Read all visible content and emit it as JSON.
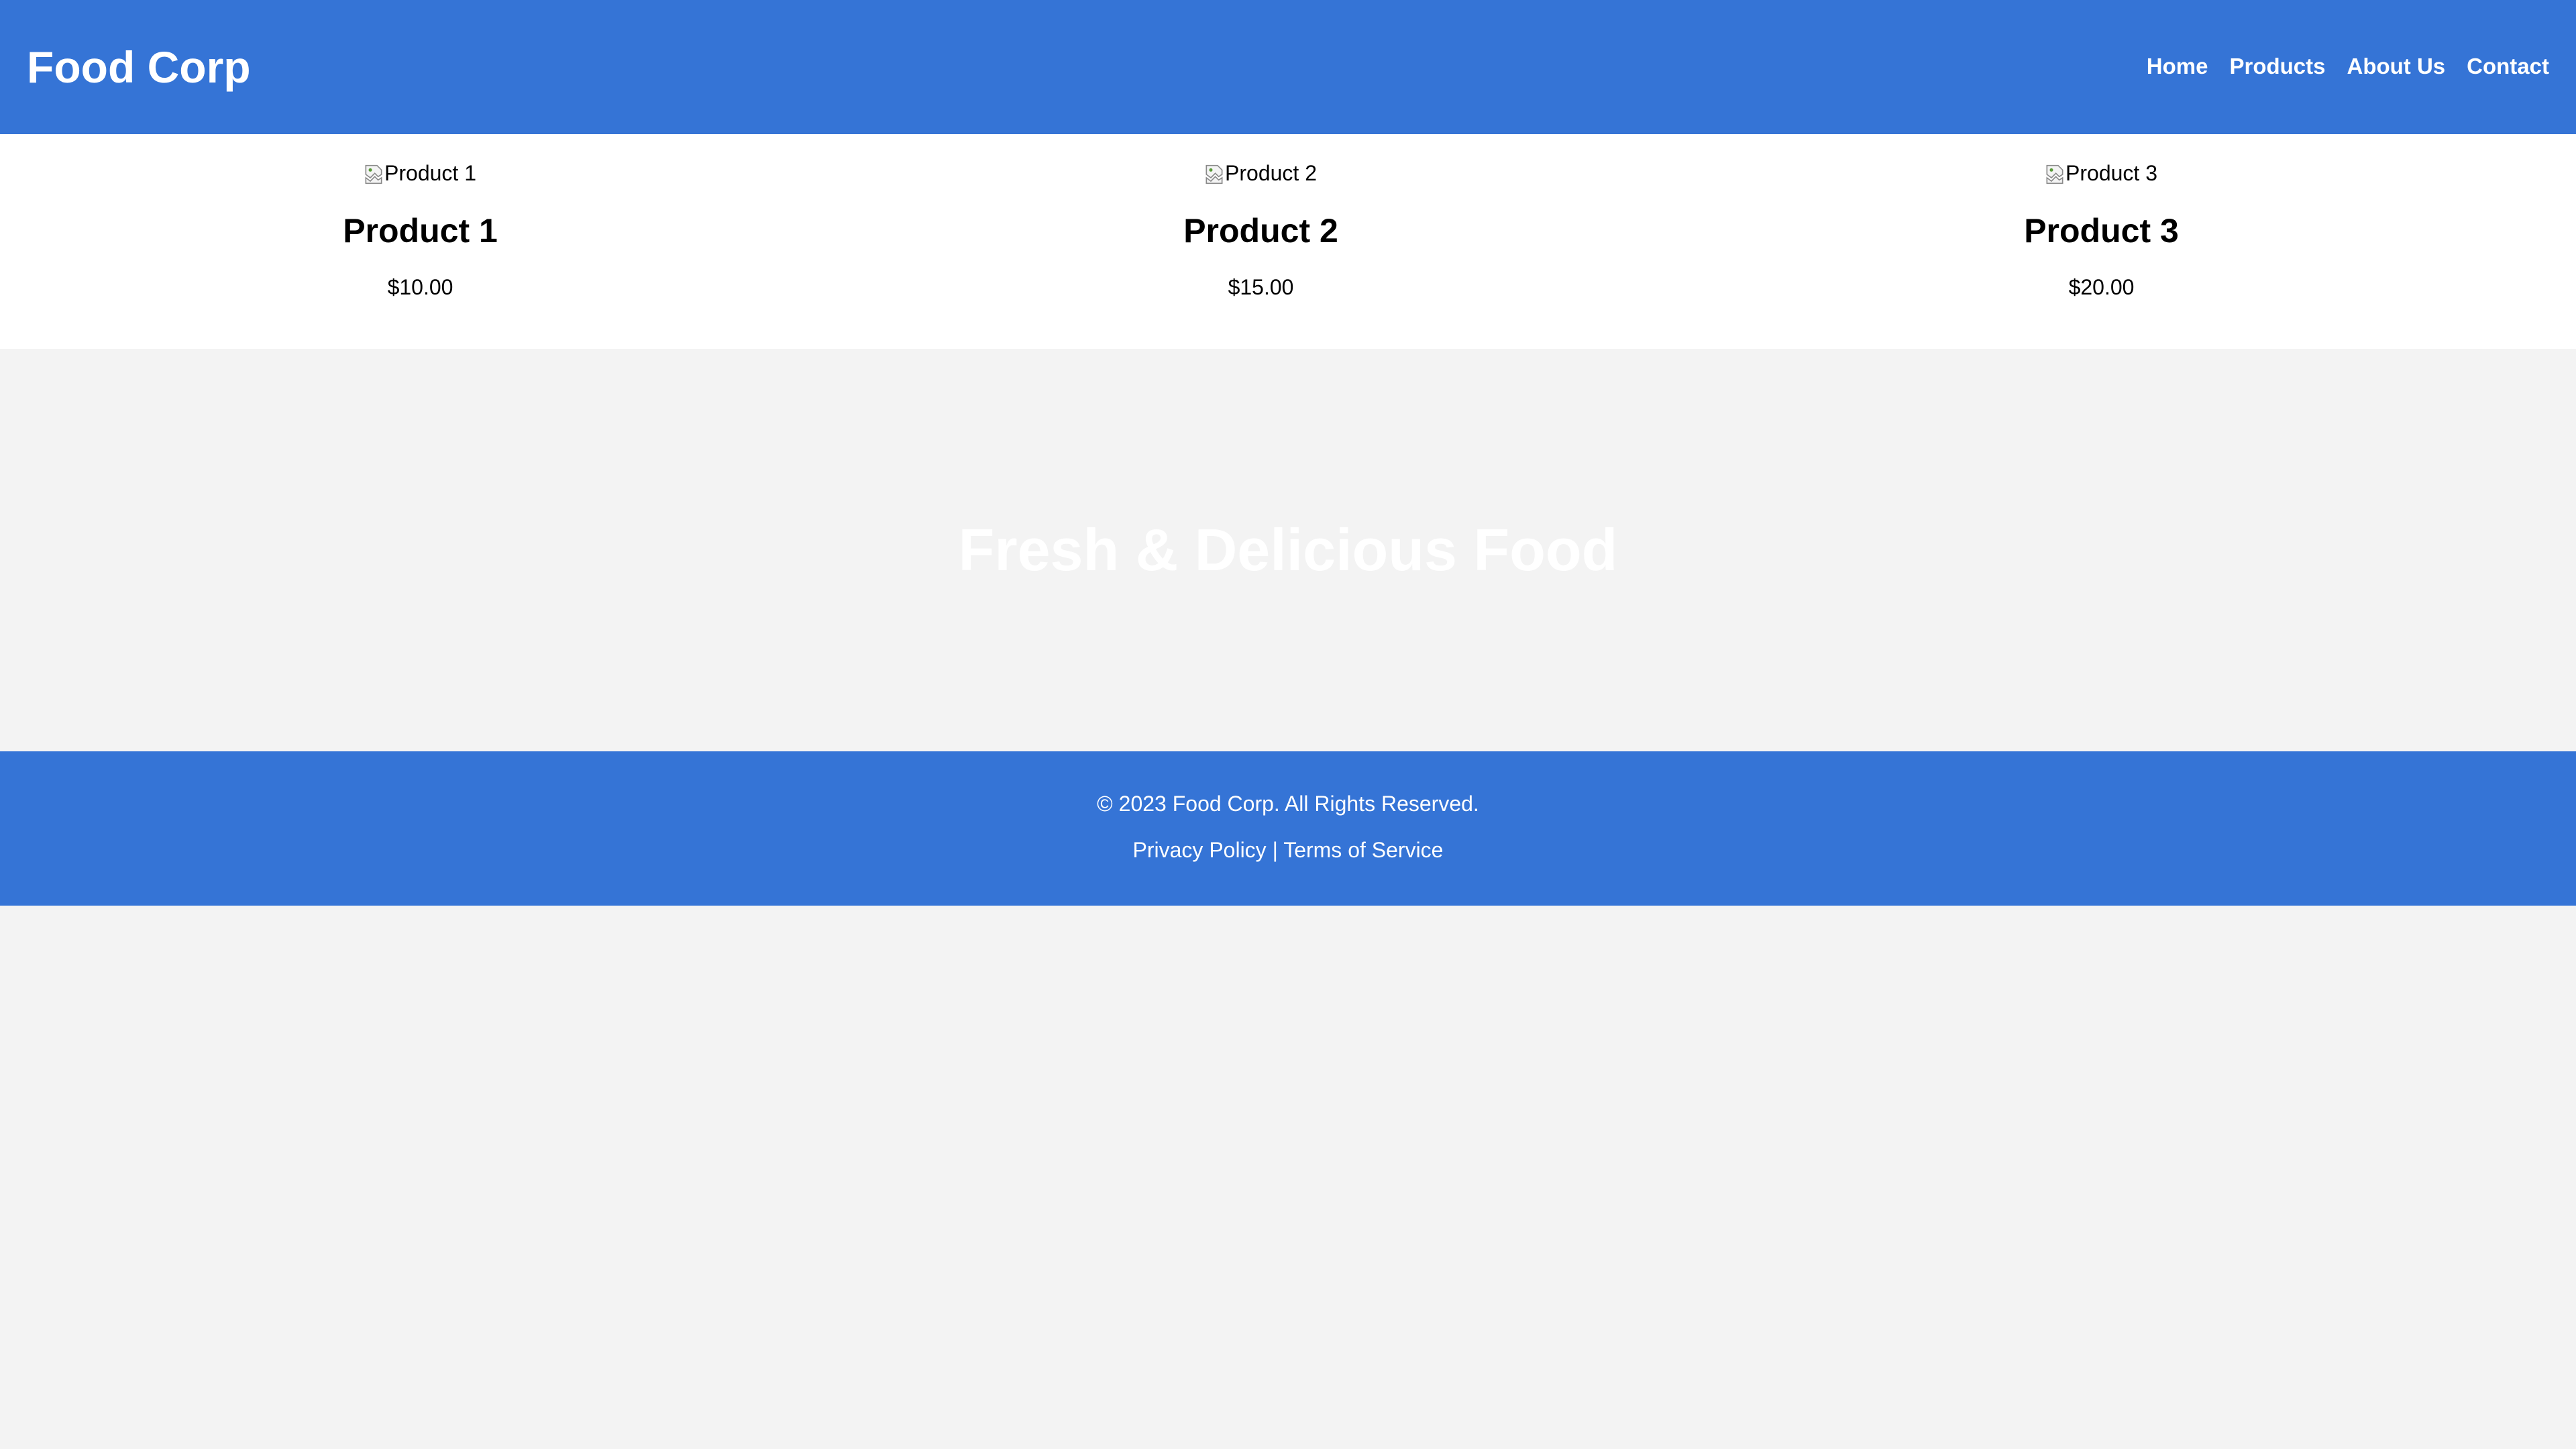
{
  "header": {
    "brand": "Food Corp",
    "nav": [
      "Home",
      "Products",
      "About Us",
      "Contact"
    ]
  },
  "products": [
    {
      "image_alt": "Product 1",
      "name": "Product 1",
      "price": "$10.00"
    },
    {
      "image_alt": "Product 2",
      "name": "Product 2",
      "price": "$15.00"
    },
    {
      "image_alt": "Product 3",
      "name": "Product 3",
      "price": "$20.00"
    }
  ],
  "hero": {
    "title": "Fresh & Delicious Food"
  },
  "footer": {
    "copyright": "© 2023 Food Corp. All Rights Reserved.",
    "privacy": "Privacy Policy",
    "separator": "|",
    "terms": "Terms of Service"
  },
  "icons": {
    "broken_image": "broken-image-icon"
  },
  "colors": {
    "header_bg": "#3574d6",
    "footer_bg": "#3574d6",
    "page_bg": "#f3f3f3",
    "products_bg": "#ffffff"
  }
}
